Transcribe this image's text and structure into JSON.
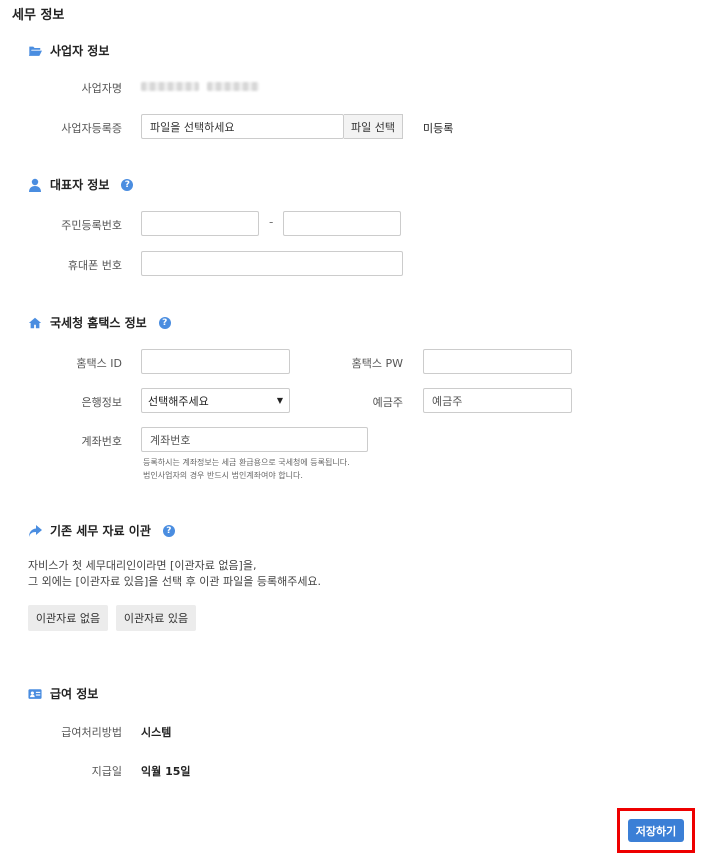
{
  "page_title": "세무 정보",
  "business": {
    "title": "사업자 정보",
    "name_label": "사업자명",
    "reg_label": "사업자등록증",
    "file_placeholder": "파일을 선택하세요",
    "file_button": "파일 선택",
    "reg_status": "미등록"
  },
  "representative": {
    "title": "대표자 정보",
    "rrn_label": "주민등록번호",
    "rrn_separator": "-",
    "phone_label": "휴대폰 번호"
  },
  "hometax": {
    "title": "국세청 홈택스 정보",
    "id_label": "홈택스 ID",
    "pw_label": "홈택스 PW",
    "bank_label": "은행정보",
    "bank_selected": "선택해주세요",
    "holder_label": "예금주",
    "holder_placeholder": "예금주",
    "account_label": "계좌번호",
    "account_placeholder": "계좌번호",
    "hint_line1": "등록하시는 계좌정보는 세금 환급용으로 국세청에 등록됩니다.",
    "hint_line2": "법인사업자의 경우 반드시 법인계좌여야 합니다."
  },
  "migration": {
    "title": "기존 세무 자료 이관",
    "desc_line1": "자비스가 첫 세무대리인이라면 [이관자료 없음]을,",
    "desc_line2": "그 외에는 [이관자료 있음]을 선택 후 이관 파일을 등록해주세요.",
    "btn_none": "이관자료 없음",
    "btn_exists": "이관자료 있음"
  },
  "payroll": {
    "title": "급여 정보",
    "method_label": "급여처리방법",
    "method_value": "시스템",
    "payday_label": "지급일",
    "payday_value": "익월 15일"
  },
  "save_button": "저장하기",
  "colors": {
    "accent": "#4a8de0",
    "save": "#3b7fd6",
    "highlight": "#e00000"
  },
  "icons": {
    "business": "folder-open-icon",
    "representative": "user-icon",
    "hometax": "home-icon",
    "migration": "share-arrow-icon",
    "payroll": "id-card-icon",
    "help": "question-circle-icon"
  }
}
